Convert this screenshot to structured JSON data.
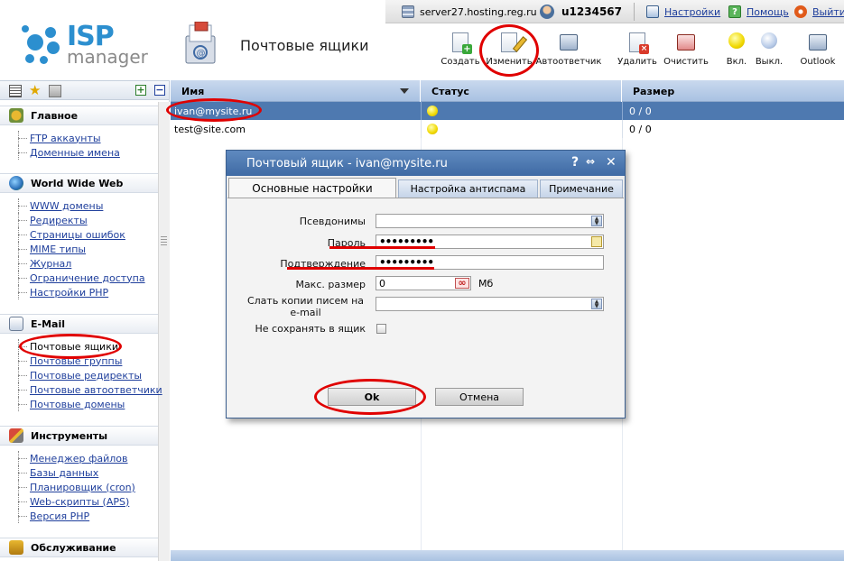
{
  "topbar": {
    "server": "server27.hosting.reg.ru ::",
    "user": "u1234567",
    "settings": "Настройки",
    "help": "Помощь",
    "exit": "Выйти"
  },
  "logo": {
    "isp": "ISP",
    "manager": "manager"
  },
  "page": {
    "title": "Почтовые ящики"
  },
  "toolbar": {
    "create": "Создать",
    "edit": "Изменить",
    "autoresponder": "Автоответчик",
    "delete": "Удалить",
    "clear": "Очистить",
    "enable": "Вкл.",
    "disable": "Выкл.",
    "outlook": "Outlook"
  },
  "sidebar": {
    "groups": [
      {
        "title": "Главное",
        "items": [
          "FTP аккаунты",
          "Доменные имена"
        ]
      },
      {
        "title": "World Wide Web",
        "items": [
          "WWW домены",
          "Редиректы",
          "Страницы ошибок",
          "MIME типы",
          "Журнал",
          "Ограничение доступа",
          "Настройки PHP"
        ]
      },
      {
        "title": "E-Mail",
        "items": [
          "Почтовые ящики",
          "Почтовые группы",
          "Почтовые редиректы",
          "Почтовые автоответчики",
          "Почтовые домены"
        ]
      },
      {
        "title": "Инструменты",
        "items": [
          "Менеджер файлов",
          "Базы данных",
          "Планировщик (cron)",
          "Web-скрипты (APS)",
          "Версия PHP"
        ]
      },
      {
        "title": "Обслуживание",
        "items": []
      }
    ]
  },
  "grid": {
    "columns": {
      "name": "Имя",
      "status": "Статус",
      "size": "Размер"
    },
    "rows": [
      {
        "name": "ivan@mysite.ru",
        "size": "0 / 0"
      },
      {
        "name": "test@site.com",
        "size": "0 / 0"
      }
    ]
  },
  "dialog": {
    "title": "Почтовый ящик - ivan@mysite.ru",
    "help": "?",
    "close": "✕",
    "tabs": [
      "Основные настройки",
      "Настройка антиспама",
      "Примечание"
    ],
    "fields": {
      "aliases_label": "Псевдонимы",
      "aliases_value": "",
      "password_label": "Пароль",
      "password_value": "•••••••••",
      "confirm_label": "Подтверждение",
      "confirm_value": "•••••••••",
      "maxsize_label": "Макс. размер",
      "maxsize_value": "0",
      "maxsize_unit": "Мб",
      "copy_label": "Слать копии писем на e-mail",
      "copy_value": "",
      "nosave_label": "Не сохранять в ящик",
      "nosave_checked": false
    },
    "buttons": {
      "ok": "Ok",
      "cancel": "Отмена"
    }
  },
  "colors": {
    "accent": "#2c8fcf",
    "header_blue": "#a9c2e2",
    "selected_row": "#4e79b0",
    "dialog_title": "#3f6aa4",
    "annotation_red": "#e00000"
  }
}
